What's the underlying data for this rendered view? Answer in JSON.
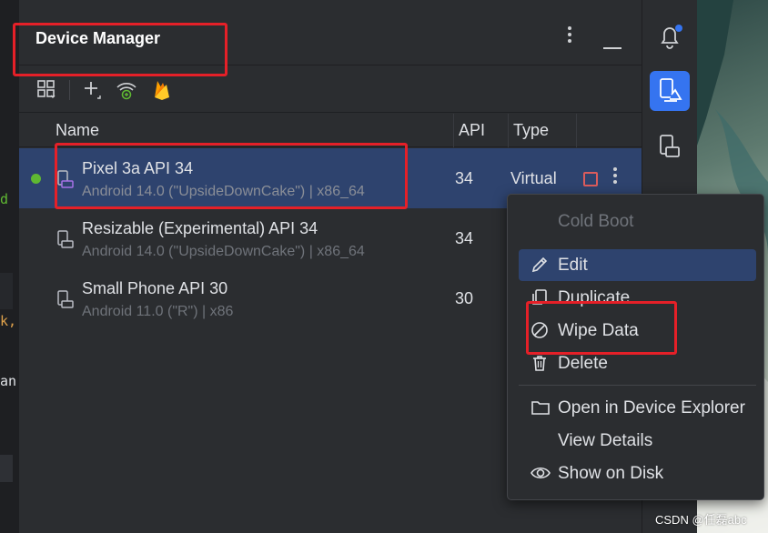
{
  "panel": {
    "title": "Device Manager"
  },
  "table": {
    "columns": {
      "name": "Name",
      "api": "API",
      "type": "Type"
    }
  },
  "devices": [
    {
      "name": "Pixel 3a API 34",
      "subtitle": "Android 14.0 (\"UpsideDownCake\") | x86_64",
      "api": "34",
      "type": "Virtual"
    },
    {
      "name": "Resizable (Experimental) API 34",
      "subtitle": "Android 14.0 (\"UpsideDownCake\") | x86_64",
      "api": "34",
      "type": ""
    },
    {
      "name": "Small Phone API 30",
      "subtitle": "Android 11.0 (\"R\") | x86",
      "api": "30",
      "type": ""
    }
  ],
  "context_menu": {
    "cold_boot": "Cold Boot",
    "edit": "Edit",
    "duplicate": "Duplicate",
    "wipe_data": "Wipe Data",
    "delete": "Delete",
    "open_explorer": "Open in Device Explorer",
    "view_details": "View Details",
    "show_on_disk": "Show on Disk"
  },
  "left_edge": {
    "g1": "d",
    "g2": "k,",
    "g3": "an"
  },
  "watermark": "CSDN @任磊abc",
  "colors": {
    "accent": "#3574f0",
    "selection": "#2e436e",
    "running": "#5fb832",
    "stop": "#db5c5c",
    "highlight": "#e52028"
  }
}
